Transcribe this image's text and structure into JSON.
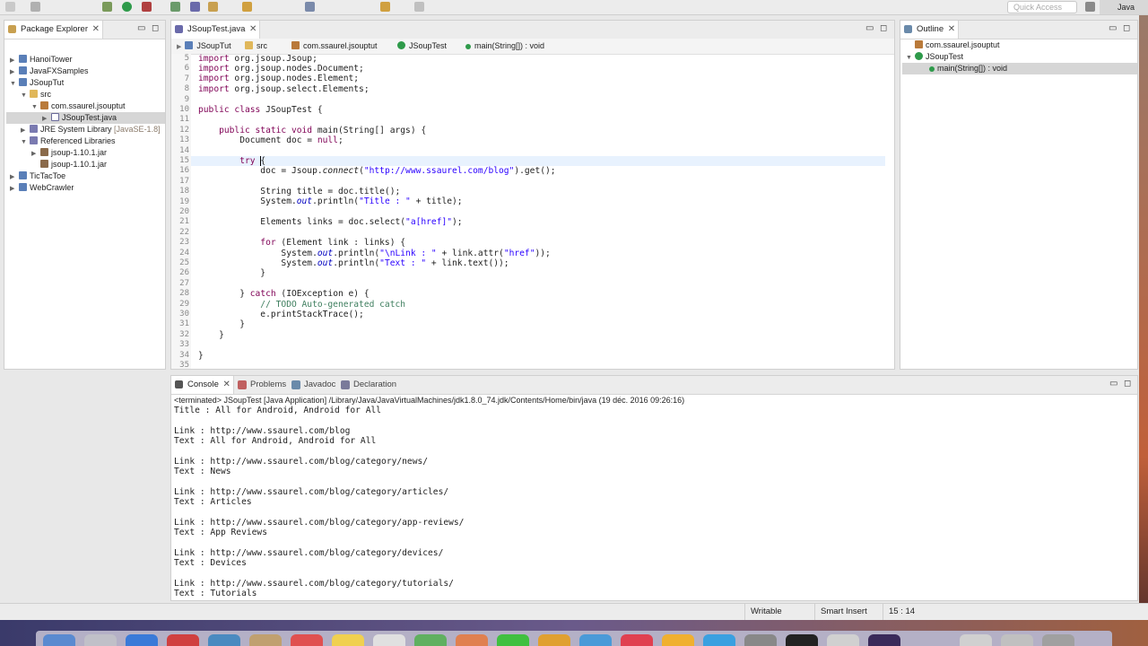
{
  "toolbar": {
    "quick_access_placeholder": "Quick Access",
    "perspective": "Java"
  },
  "package_explorer": {
    "tab_label": "Package Explorer",
    "tree": [
      {
        "label": "HanoiTower",
        "icon": "project-icon"
      },
      {
        "label": "JavaFXSamples",
        "icon": "project-icon"
      },
      {
        "label": "JSoupTut",
        "icon": "project-icon"
      },
      {
        "label": "src",
        "icon": "source-folder-icon"
      },
      {
        "label": "com.ssaurel.jsouptut",
        "icon": "package-icon"
      },
      {
        "label": "JSoupTest.java",
        "icon": "java-file-icon"
      },
      {
        "label": "JRE System Library",
        "decoration": "[JavaSE-1.8]",
        "icon": "library-icon"
      },
      {
        "label": "Referenced Libraries",
        "icon": "library-icon"
      },
      {
        "label": "jsoup-1.10.1.jar",
        "icon": "jar-icon"
      },
      {
        "label": "jsoup-1.10.1.jar",
        "icon": "jar-icon"
      },
      {
        "label": "TicTacToe",
        "icon": "project-icon"
      },
      {
        "label": "WebCrawler",
        "icon": "project-icon"
      }
    ]
  },
  "editor": {
    "tab_label": "JSoupTest.java",
    "breadcrumb": [
      "JSoupTut",
      "src",
      "com.ssaurel.jsouptut",
      "JSoupTest",
      "main(String[]) : void"
    ],
    "line_numbers": [
      "5",
      "6",
      "7",
      "8",
      "9",
      "10",
      "11",
      "12",
      "13",
      "14",
      "15",
      "16",
      "17",
      "18",
      "19",
      "20",
      "21",
      "22",
      "23",
      "24",
      "25",
      "26",
      "27",
      "28",
      "29",
      "30",
      "31",
      "32",
      "33",
      "34",
      "35"
    ],
    "lines": {
      "l5a": "import",
      "l5b": " org.jsoup.Jsoup;",
      "l6a": "import",
      "l6b": " org.jsoup.nodes.Document;",
      "l7a": "import",
      "l7b": " org.jsoup.nodes.Element;",
      "l8a": "import",
      "l8b": " org.jsoup.select.Elements;",
      "l10a": "public class",
      "l10b": " JSoupTest {",
      "l12a": "    public static void",
      "l12b": " main(String[] args) {",
      "l13": "        Document doc = ",
      "l13b": "null",
      "l13c": ";",
      "l15a": "        try",
      "l15b": " {",
      "l16a": "            doc = Jsoup.",
      "l16b": "connect",
      "l16c": "(",
      "l16d": "\"http://www.ssaurel.com/blog\"",
      "l16e": ").get();",
      "l18": "            String title = doc.title();",
      "l19a": "            System.",
      "l19b": "out",
      "l19c": ".println(",
      "l19d": "\"Title : \"",
      "l19e": " + title);",
      "l21a": "            Elements links = doc.select(",
      "l21b": "\"a[href]\"",
      "l21c": ");",
      "l23a": "            for",
      "l23b": " (Element link : links) {",
      "l24a": "                System.",
      "l24b": "out",
      "l24c": ".println(",
      "l24d": "\"\\nLink : \"",
      "l24e": " + link.attr(",
      "l24f": "\"href\"",
      "l24g": "));",
      "l25a": "                System.",
      "l25b": "out",
      "l25c": ".println(",
      "l25d": "\"Text : \"",
      "l25e": " + link.text());",
      "l26": "            }",
      "l28a": "        } ",
      "l28b": "catch",
      "l28c": " (IOException e) {",
      "l29": "            // TODO Auto-generated catch",
      "l30": "            e.printStackTrace();",
      "l31": "        }",
      "l32": "    }",
      "l34": "}"
    }
  },
  "outline": {
    "tab_label": "Outline",
    "items": [
      "com.ssaurel.jsouptut",
      "JSoupTest",
      "main(String[]) : void"
    ]
  },
  "console": {
    "tabs": [
      "Console",
      "Problems",
      "Javadoc",
      "Declaration"
    ],
    "header": "<terminated> JSoupTest [Java Application] /Library/Java/JavaVirtualMachines/jdk1.8.0_74.jdk/Contents/Home/bin/java (19 déc. 2016 09:26:16)",
    "output": [
      "Title : All for Android, Android for All",
      "",
      "Link : http://www.ssaurel.com/blog",
      "Text : All for Android, Android for All",
      "",
      "Link : http://www.ssaurel.com/blog/category/news/",
      "Text : News",
      "",
      "Link : http://www.ssaurel.com/blog/category/articles/",
      "Text : Articles",
      "",
      "Link : http://www.ssaurel.com/blog/category/app-reviews/",
      "Text : App Reviews",
      "",
      "Link : http://www.ssaurel.com/blog/category/devices/",
      "Text : Devices",
      "",
      "Link : http://www.ssaurel.com/blog/category/tutorials/",
      "Text : Tutorials"
    ]
  },
  "status": {
    "writable": "Writable",
    "insert_mode": "Smart Insert",
    "position": "15 : 14"
  }
}
